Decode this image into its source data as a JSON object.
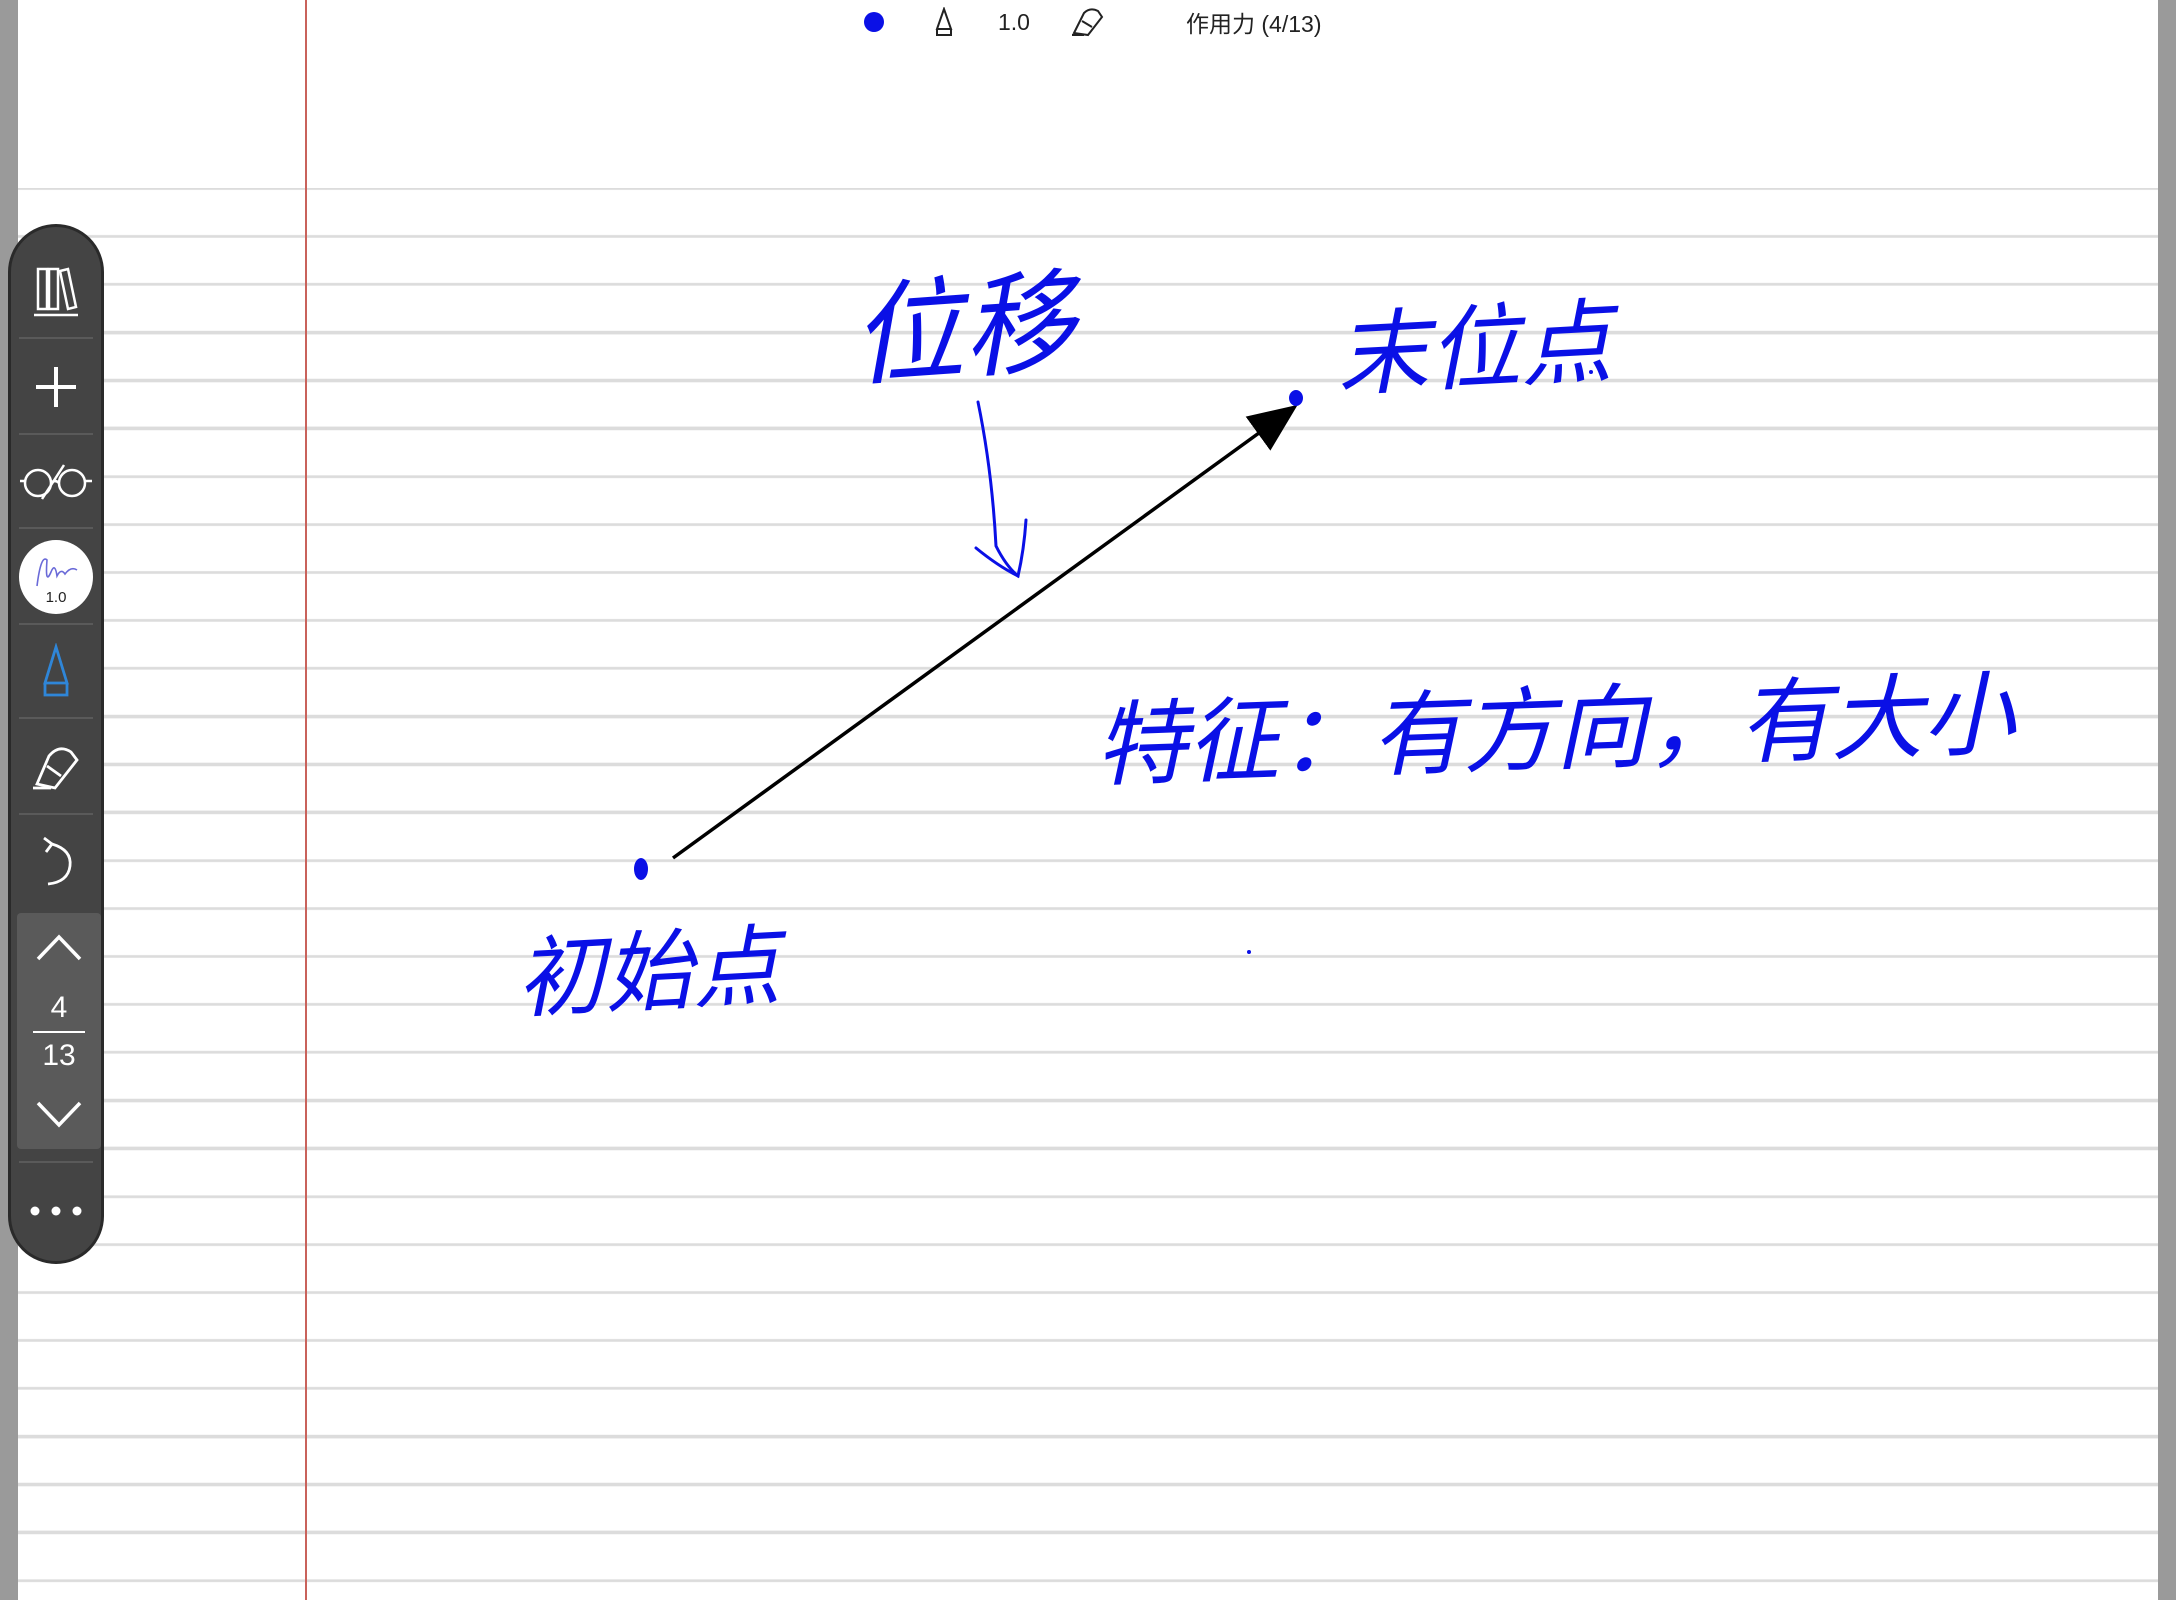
{
  "topbar": {
    "color_name": "blue",
    "pen_size": "1.0",
    "title": "作用力 (4/13)"
  },
  "toolbar": {
    "items": [
      {
        "icon": "library-icon"
      },
      {
        "icon": "add-icon"
      },
      {
        "icon": "read-mode-icon"
      },
      {
        "icon": "pen-preview-icon",
        "value": "1.0"
      },
      {
        "icon": "pen-tool-icon"
      },
      {
        "icon": "eraser-hand-icon"
      },
      {
        "icon": "undo-icon"
      }
    ],
    "page_current": "4",
    "page_total": "13",
    "more_icon": "more-icon"
  },
  "colors": {
    "ink": "#0a10e6",
    "toolbar": "#444444",
    "margin": "#c9625b",
    "accent": "#2f86d8"
  },
  "notes": {
    "label_displacement": "位移",
    "label_end": "末位点",
    "label_start": "初始点",
    "label_feature": "特征：有方向，有大小"
  }
}
